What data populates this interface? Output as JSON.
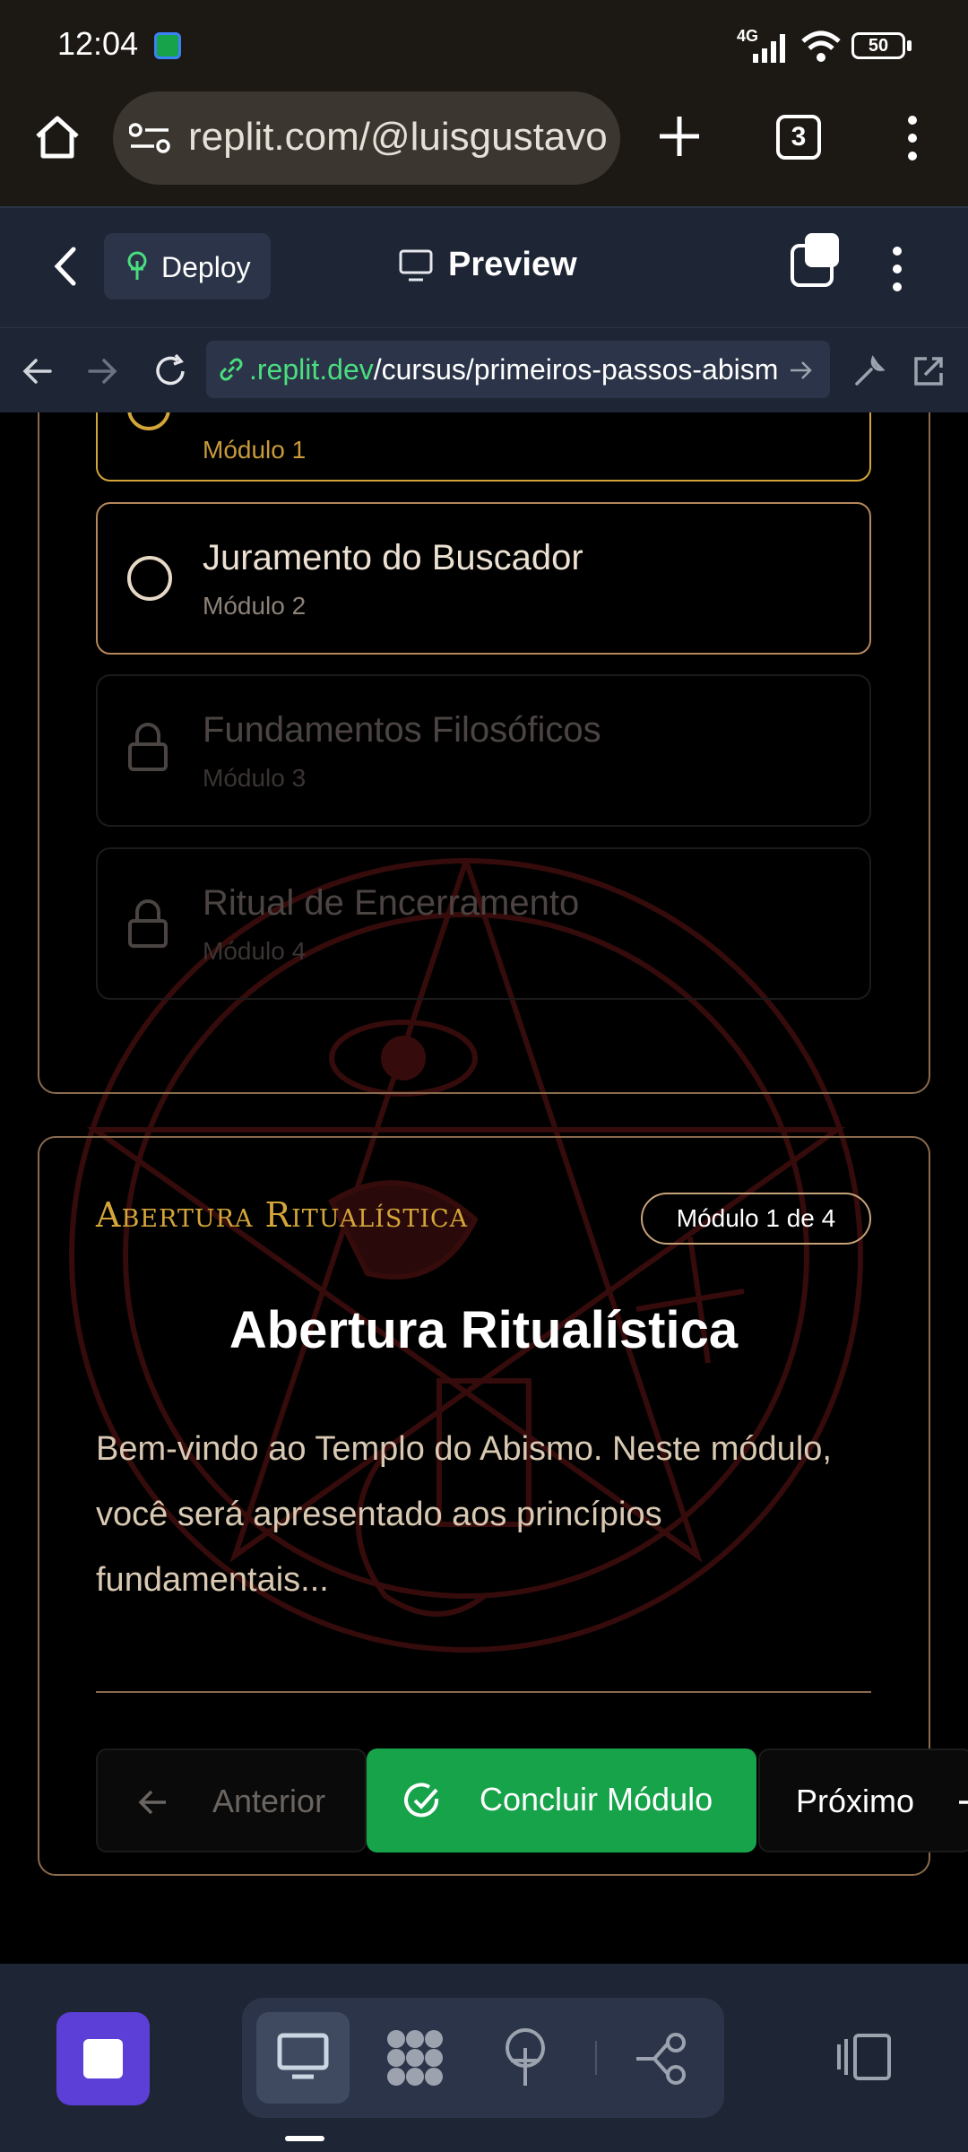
{
  "status_bar": {
    "time": "12:04",
    "network": "4G",
    "battery": "50"
  },
  "browser": {
    "url": "replit.com/@luisgustavo",
    "tab_count": "3"
  },
  "replit_header": {
    "deploy_label": "Deploy",
    "preview_label": "Preview"
  },
  "webview": {
    "url_domain": ".replit.dev",
    "url_path": "/cursus/primeiros-passos-abism"
  },
  "modules": [
    {
      "title": "",
      "subtitle": "Módulo 1",
      "state": "active"
    },
    {
      "title": "Juramento do Buscador",
      "subtitle": "Módulo 2",
      "state": "available"
    },
    {
      "title": "Fundamentos Filosóficos",
      "subtitle": "Módulo 3",
      "state": "locked"
    },
    {
      "title": "Ritual de Encerramento",
      "subtitle": "Módulo 4",
      "state": "locked"
    }
  ],
  "lesson": {
    "kicker": "Abertura Ritualística",
    "badge": "Módulo 1 de 4",
    "title": "Abertura Ritualística",
    "body": "Bem-vindo ao Templo do Abismo. Neste módulo, você será apresentado aos princípios fundamentais...",
    "prev_label": "Anterior",
    "complete_label": "Concluir Módulo",
    "next_label": "Próximo"
  },
  "colors": {
    "gold": "#d4a63a",
    "green": "#16a34a",
    "card_border": "#8a6a4e",
    "panel": "#1e2535"
  }
}
